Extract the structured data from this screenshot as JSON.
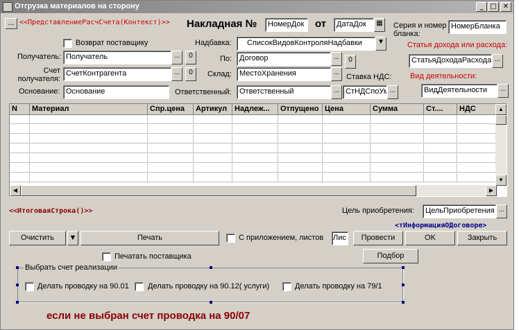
{
  "window": {
    "title": "Отгрузка материалов на сторону",
    "min_label": "_",
    "max_label": "□",
    "close_label": "✕"
  },
  "header": {
    "dots_label": "...",
    "represent": "<<ПредставлениеРасчСчета(Контекст)>>",
    "invoice_label": "Накладная №",
    "invoice_number": "НомерДок",
    "from_label": "от",
    "date": "ДатаДок",
    "series_label": "Серия и номер бланка:",
    "series_value": "НомерБланка"
  },
  "form": {
    "return_label": "Возврат поставщику",
    "recipient_label": "Получатель:",
    "recipient_value": "Получатель",
    "account_label": "Счет получателя:",
    "account_value": "СчетКонтрагента",
    "basis_label": "Основание:",
    "basis_value": "Основание",
    "markup_label": "Надбавка:",
    "markup_value": "СписокВидовКонтроляНадбавки",
    "by_label": "По:",
    "by_value": "Договор",
    "warehouse_label": "Склад:",
    "warehouse_value": "МестоХранения",
    "responsible_label": "Ответственный:",
    "responsible_value": "Ответственный",
    "vat_label": "Ставка НДС:",
    "vat_value": "СтНДСпоУм",
    "income_label": "Статья дохода или расхода:",
    "income_value": "СтатьяДоходаРасхода",
    "activity_label": "Вид деятельности:",
    "activity_value": "ВидДеятельности",
    "o_label": "0",
    "dots": "...",
    "dropdown_arrow": "▼"
  },
  "table": {
    "columns": [
      "N",
      "Материал",
      "Спр.цена",
      "Артикул",
      "Надлеж...",
      "Отпущено",
      "Цена",
      "Сумма",
      "Ст....",
      "НДС"
    ]
  },
  "footer": {
    "total_line": "<<ИтоговаяСтрока()>>",
    "purpose_label": "Цель приобретения:",
    "purpose_value": "ЦельПриобретения",
    "contract_info": "<тИнформацияОДоговоре>",
    "clear_label": "Очистить",
    "print_label": "Печать",
    "attach_label": "С приложением, листов",
    "attach_value": "Лис",
    "post_label": "Провести",
    "ok_label": "OK",
    "close_label": "Закрыть",
    "print_supplier_label": "Печатать поставщика",
    "selection_label": "Подбор",
    "group_title": "Выбрать счет реализации",
    "post_9001": "Делать проводку на 90.01",
    "post_9012": "Делать проводку на 90.12( услуги)",
    "post_791": "Делать проводку на 79/1",
    "note": "если не выбран счет проводка на 90/07"
  }
}
